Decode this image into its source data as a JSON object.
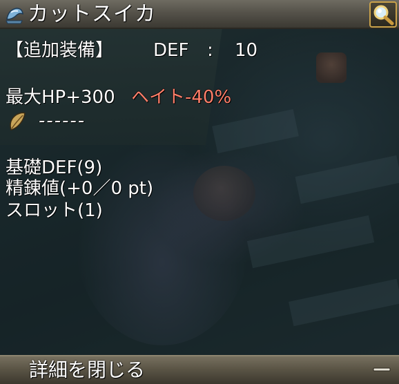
{
  "window": {
    "item_name": "カットスイカ",
    "title_icon": "helmet-icon",
    "search_icon": "magnifier-icon"
  },
  "stats": {
    "additional_equip_label": "【追加装備】",
    "def_label": "DEF",
    "def_separator": ":",
    "def_value": "10",
    "effect_hp": "最大HP+300",
    "effect_hate": "ヘイト-40%",
    "slot_line": "------",
    "slot_icon": "leaf-icon",
    "base_def": "基礎DEF(9)",
    "refine": "精錬値(+0／0 pt)",
    "slots": "スロット(1)"
  },
  "footer": {
    "close_details_label": "詳細を閉じる",
    "collapse_icon": "minus-icon"
  },
  "colors": {
    "hate_text": "#ff7f6a",
    "title_bar": "#55524a",
    "search_border": "#caa24a"
  }
}
